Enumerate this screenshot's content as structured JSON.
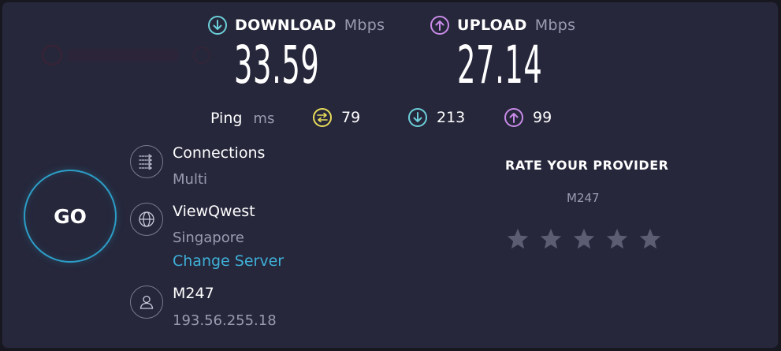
{
  "download": {
    "label": "DOWNLOAD",
    "unit": "Mbps",
    "value": "33.59",
    "icon": "arrow-down-circle-icon",
    "color": "#6ccfd9"
  },
  "upload": {
    "label": "UPLOAD",
    "unit": "Mbps",
    "value": "27.14",
    "icon": "arrow-up-circle-icon",
    "color": "#c98be8"
  },
  "ping": {
    "label": "Ping",
    "unit": "ms",
    "idle": {
      "value": "79",
      "icon": "latency-icon",
      "color": "#e9dd5a"
    },
    "download": {
      "value": "213",
      "icon": "arrow-down-circle-icon",
      "color": "#6ccfd9"
    },
    "upload": {
      "value": "99",
      "icon": "arrow-up-circle-icon",
      "color": "#c98be8"
    }
  },
  "go_button": {
    "label": "GO",
    "color": "#2c9ec7"
  },
  "connections": {
    "title": "Connections",
    "value": "Multi",
    "icon": "connections-icon"
  },
  "server": {
    "name": "ViewQwest",
    "location": "Singapore",
    "change_label": "Change Server",
    "icon": "globe-icon"
  },
  "provider": {
    "name": "M247",
    "ip": "193.56.255.18",
    "icon": "user-icon"
  },
  "rate": {
    "title": "RATE YOUR PROVIDER",
    "provider": "M247",
    "stars": 5
  }
}
